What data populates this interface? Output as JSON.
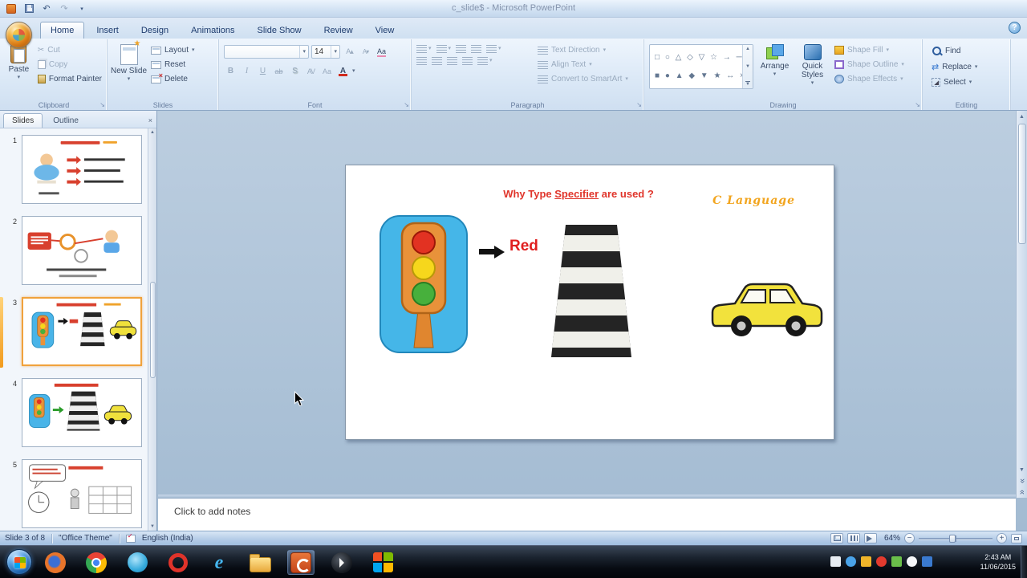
{
  "titlebar": {
    "title": "c_slide$ - Microsoft PowerPoint"
  },
  "tabs": [
    {
      "label": "Home"
    },
    {
      "label": "Insert"
    },
    {
      "label": "Design"
    },
    {
      "label": "Animations"
    },
    {
      "label": "Slide Show"
    },
    {
      "label": "Review"
    },
    {
      "label": "View"
    }
  ],
  "ribbon": {
    "clipboard": {
      "group": "Clipboard",
      "paste": "Paste",
      "cut": "Cut",
      "copy": "Copy",
      "format_painter": "Format Painter"
    },
    "slides": {
      "group": "Slides",
      "new_slide": "New Slide",
      "layout": "Layout",
      "reset": "Reset",
      "delete": "Delete"
    },
    "font": {
      "group": "Font",
      "name": "",
      "size": "14"
    },
    "paragraph": {
      "group": "Paragraph",
      "text_direction": "Text Direction",
      "align_text": "Align Text",
      "smartart": "Convert to SmartArt"
    },
    "drawing": {
      "group": "Drawing",
      "arrange": "Arrange",
      "quick_styles": "Quick Styles",
      "shape_fill": "Shape Fill",
      "shape_outline": "Shape Outline",
      "shape_effects": "Shape Effects"
    },
    "editing": {
      "group": "Editing",
      "find": "Find",
      "replace": "Replace",
      "select": "Select"
    }
  },
  "sidebar": {
    "tab_slides": "Slides",
    "tab_outline": "Outline",
    "slide_numbers": [
      "1",
      "2",
      "3",
      "4",
      "5"
    ]
  },
  "slide": {
    "title_pre": "Why Type ",
    "title_underlined": "Specifier",
    "title_post": " are used ?",
    "brand": "C Language",
    "signal_label": "Red"
  },
  "notes": {
    "placeholder": "Click to add notes"
  },
  "statusbar": {
    "slide_info": "Slide 3 of 8",
    "theme": "\"Office Theme\"",
    "language": "English (India)",
    "zoom": "64%"
  },
  "taskbar": {
    "time": "2:43 AM",
    "date": "11/06/2015"
  },
  "icons": {
    "dropdown": "▾",
    "cut": "✂",
    "undo": "↶",
    "redo": "↷",
    "office-orb": "office-logo",
    "start": "windows-flag"
  }
}
